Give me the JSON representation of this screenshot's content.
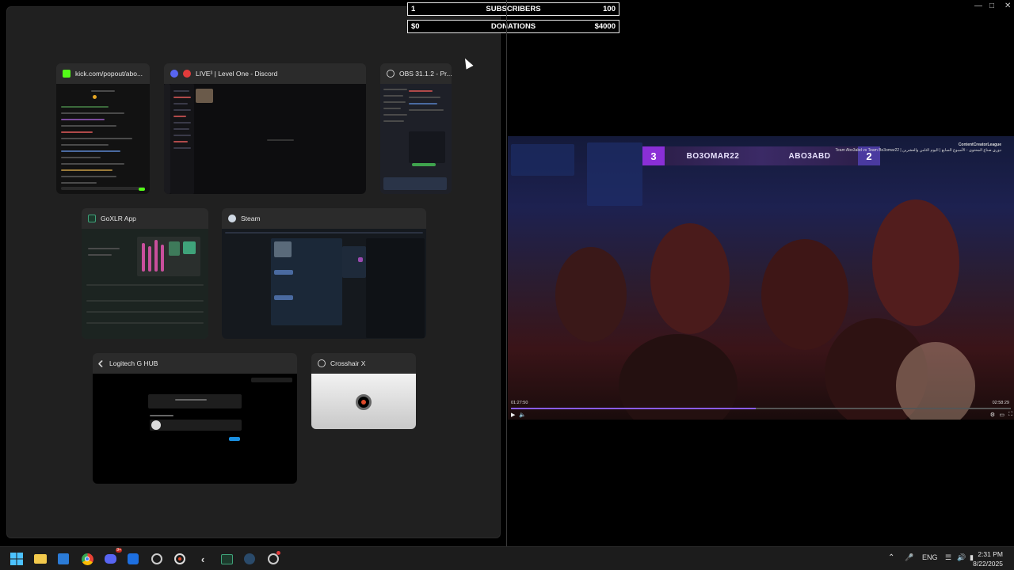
{
  "stats": {
    "subs_left": "1",
    "subs_label": "SUBSCRIBERS",
    "subs_right": "100",
    "don_left": "$0",
    "don_label": "DONATIONS",
    "don_right": "$4000"
  },
  "windows": {
    "kick": {
      "title": "kick.com/popout/abo...",
      "icon": "kick-icon",
      "color": "#53fc18"
    },
    "discord": {
      "title": "LIVE³ | Level One - Discord",
      "icon": "discord-icon",
      "color": "#5865f2"
    },
    "obs": {
      "title": "OBS 31.1.2 - Pr...",
      "icon": "obs-icon",
      "color": "#cfcfcf"
    },
    "goxlr": {
      "title": "GoXLR App",
      "icon": "goxlr-icon",
      "color": "#1c3a2c"
    },
    "steam": {
      "title": "Steam",
      "icon": "steam-icon",
      "color": "#cfd8e3"
    },
    "ghub": {
      "title": "Logitech G HUB",
      "icon": "logitech-icon",
      "color": "#cfcfcf"
    },
    "crosshair": {
      "title": "Crosshair X",
      "icon": "crosshair-icon",
      "color": "#cfcfcf"
    }
  },
  "video": {
    "score_left": "3",
    "team_left": "BO3OMAR22",
    "team_right": "ABO3ABD",
    "score_right": "2",
    "channel": "ContentCreatorLeague",
    "title": "Team Abo3abd vs Team Bo3omar22 | دوري صناع المحتوى - الأسبوع السابع | اليوم الثامن والعشرين",
    "elapsed": "01:27:50",
    "duration": "02:58:29",
    "progress": 0.49
  },
  "taskbar": {
    "lang": "ENG",
    "time": "2:31 PM",
    "date": "8/22/2025",
    "discord_badge": "9+"
  }
}
